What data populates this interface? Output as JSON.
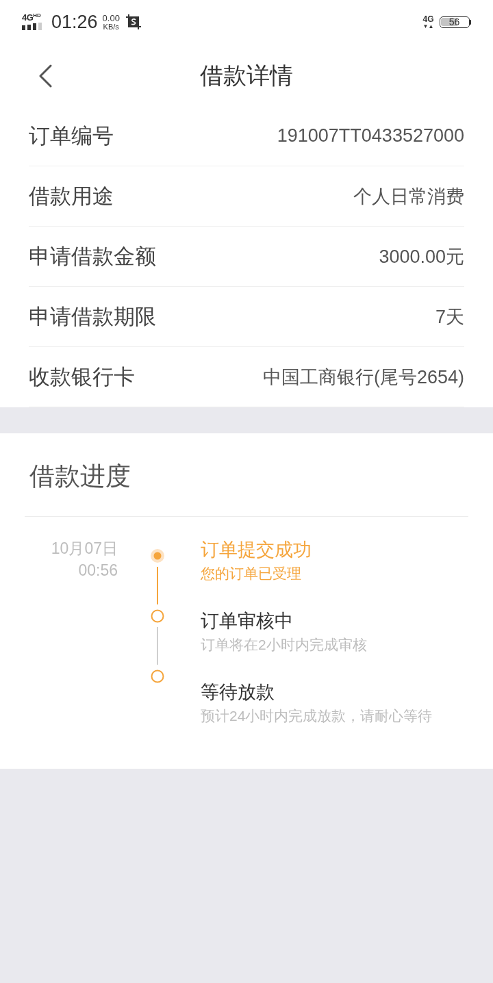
{
  "status_bar": {
    "network": "4G",
    "network_badge": "HD",
    "time": "01:26",
    "speed_value": "0.00",
    "speed_unit": "KB/s",
    "data_type": "4G",
    "data_arrows": "▼▲",
    "battery": {
      "text": "56",
      "level": 0.56
    }
  },
  "header": {
    "title": "借款详情"
  },
  "details": [
    {
      "label": "订单编号",
      "value": "191007TT0433527000"
    },
    {
      "label": "借款用途",
      "value": "个人日常消费"
    },
    {
      "label": "申请借款金额",
      "value": "3000.00元"
    },
    {
      "label": "申请借款期限",
      "value": "7天"
    },
    {
      "label": "收款银行卡",
      "value": "中国工商银行(尾号2654)"
    }
  ],
  "progress": {
    "title": "借款进度",
    "steps": [
      {
        "title": "订单提交成功",
        "subtitle": "您的订单已受理",
        "done": true,
        "date": "10月07日",
        "time": "00:56"
      },
      {
        "title": "订单审核中",
        "subtitle": "订单将在2小时内完成审核",
        "done": false
      },
      {
        "title": "等待放款",
        "subtitle": "预计24小时内完成放款，请耐心等待",
        "done": false
      }
    ]
  }
}
